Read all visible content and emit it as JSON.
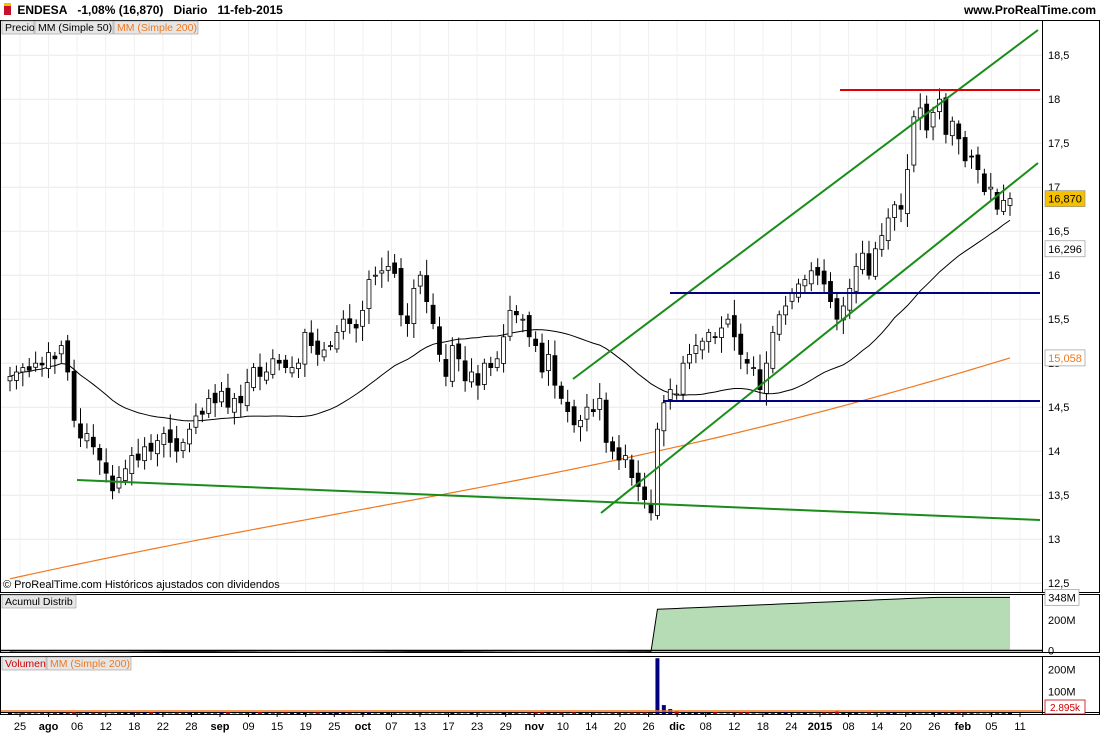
{
  "header": {
    "ticker": "ENDESA",
    "change": "-1,08% (16,870)",
    "period": "Diario",
    "date": "11-feb-2015",
    "site": "www.ProRealTime.com"
  },
  "legend": {
    "price": "Precio",
    "ma50": "MM (Simple 50)",
    "ma200": "MM (Simple 200)",
    "acc_title": "Acumul Distrib",
    "vol_title": "Volumen",
    "vol_ma200": "MM (Simple 200)",
    "copyright": "© ProRealTime.com Históricos ajustados con dividendos"
  },
  "colors": {
    "up": "#ffffff",
    "down": "#000000",
    "ma50": "#000000",
    "ma200": "#f07820",
    "trend": "#1a8c1a",
    "resistance": "#e00000",
    "support": "#000080",
    "acc_fill": "#b5dcb5",
    "vol_up": "#000080",
    "vol_down": "#cc0000",
    "price_badge": "#f5c000"
  },
  "x_labels": [
    "25",
    "ago",
    "06",
    "12",
    "18",
    "22",
    "28",
    "sep",
    "09",
    "15",
    "19",
    "25",
    "oct",
    "07",
    "13",
    "17",
    "23",
    "29",
    "nov",
    "10",
    "14",
    "20",
    "26",
    "dic",
    "08",
    "12",
    "18",
    "24",
    "2015",
    "08",
    "14",
    "20",
    "26",
    "feb",
    "05",
    "11"
  ],
  "volume_axis": {
    "labels": [
      "200M",
      "100M"
    ],
    "current": "2.895k"
  },
  "chart_data": [
    {
      "type": "candlestick",
      "title": "ENDESA",
      "ylim": [
        12.4,
        18.9
      ],
      "yticks": [
        "18,5",
        "18",
        "17,5",
        "17",
        "16,5",
        "16",
        "15,5",
        "15",
        "14,5",
        "14",
        "13,5",
        "13",
        "12,5"
      ],
      "last_price": "16,870",
      "ma50_last": "16,296",
      "ma200_last": "15,058",
      "closes": [
        14.85,
        14.9,
        14.95,
        14.92,
        15.0,
        14.98,
        15.12,
        15.05,
        15.2,
        14.9,
        14.35,
        14.15,
        14.2,
        14.05,
        13.9,
        13.75,
        13.55,
        13.7,
        13.8,
        13.95,
        13.9,
        14.05,
        14.0,
        14.12,
        14.2,
        14.1,
        14.0,
        14.1,
        14.25,
        14.4,
        14.42,
        14.6,
        14.55,
        14.68,
        14.5,
        14.6,
        14.55,
        14.78,
        14.95,
        14.85,
        14.9,
        15.05,
        15.0,
        14.95,
        14.95,
        15.0,
        15.35,
        15.2,
        15.1,
        15.15,
        15.2,
        15.35,
        15.5,
        15.45,
        15.4,
        15.6,
        15.95,
        16.0,
        16.05,
        16.1,
        16.02,
        15.55,
        15.45,
        15.85,
        16.0,
        15.7,
        15.45,
        15.1,
        14.85,
        15.2,
        15.05,
        14.8,
        14.9,
        14.75,
        15.0,
        14.95,
        15.05,
        15.3,
        15.6,
        15.55,
        15.5,
        15.3,
        15.2,
        14.9,
        15.1,
        14.75,
        14.6,
        14.45,
        14.3,
        14.35,
        14.5,
        14.45,
        14.6,
        14.1,
        14.0,
        13.9,
        13.95,
        13.7,
        13.6,
        13.45,
        13.3,
        14.25,
        14.55,
        14.7,
        14.65,
        15.0,
        15.1,
        15.2,
        15.25,
        15.35,
        15.3,
        15.4,
        15.5,
        15.3,
        15.1,
        15.0,
        14.95,
        14.7,
        15.0,
        15.35,
        15.55,
        15.65,
        15.8,
        15.9,
        15.95,
        16.05,
        16.0,
        15.9,
        15.7,
        15.5,
        15.65,
        15.85,
        16.1,
        16.25,
        16.0,
        16.3,
        16.45,
        16.65,
        16.8,
        16.75,
        17.2,
        17.8,
        17.9,
        17.65,
        17.85,
        18.0,
        17.6,
        17.75,
        17.55,
        17.3,
        17.35,
        17.2,
        16.95,
        17.0,
        16.75,
        16.85,
        16.87
      ]
    },
    {
      "type": "area",
      "title": "Acumul Distrib",
      "ylim": [
        -10,
        370
      ],
      "yticks": [
        "200M",
        "0"
      ],
      "last_value": "348M"
    },
    {
      "type": "bar",
      "title": "Volumen",
      "ylim": [
        0,
        260
      ],
      "yticks": [
        "200M",
        "100M"
      ],
      "last_value": "2.895k"
    }
  ]
}
